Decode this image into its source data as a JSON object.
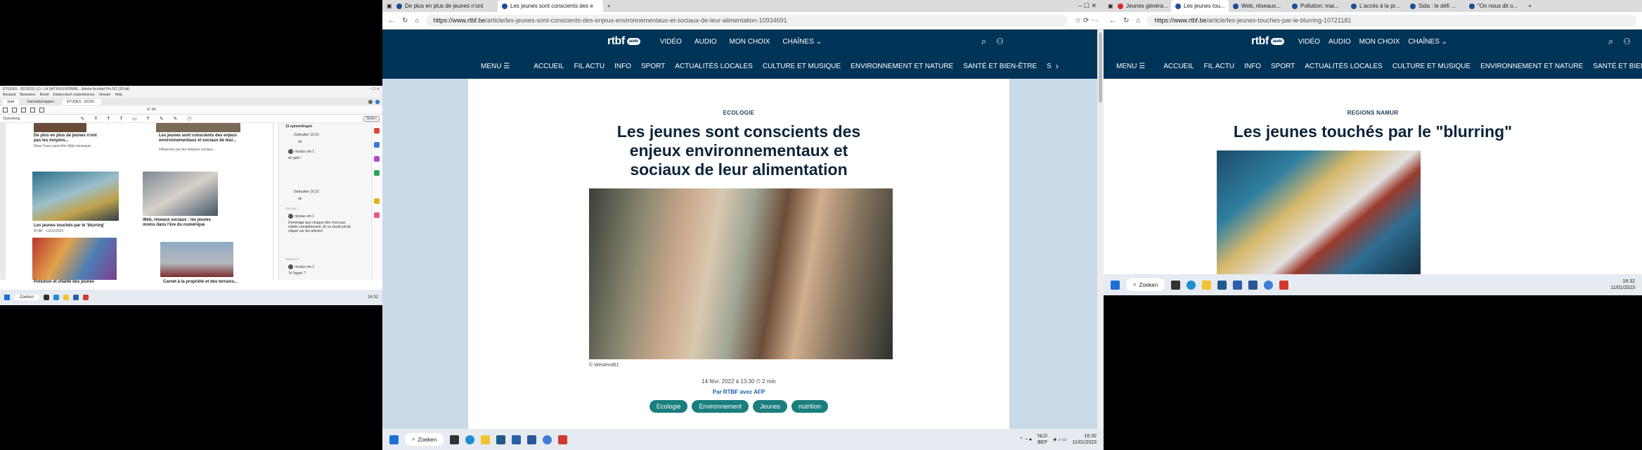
{
  "left_app": {
    "title": "ETUDES - 20230111 (1) - LA SAT EN EXPRIME... Adobe Acrobat Pro DC (32-bit)",
    "menu": [
      "Bestand",
      "Bewerken",
      "Beeld",
      "Elektronisch ondertekenen",
      "Venster",
      "Help"
    ],
    "tabs": [
      "Start",
      "Gereedschappen",
      "ETUDES - 20230..."
    ],
    "page_indicator": "9 / 43",
    "left_label": "Opmerking",
    "share_button": "Sluiten",
    "articles": [
      {
        "title": "De plus en plus de jeunes n'ont pas les moyens...",
        "text": "Nous l'avez peut-être déjà remarqué..."
      },
      {
        "title": "Les jeunes sont conscients des enjeux environnementaux et sociaux de leur...",
        "text": "Influencés par les réseaux sociaux..."
      },
      {
        "title": "Les jeunes touchés par le 'blurring'",
        "text": "RTBF · 11/01/2023"
      },
      {
        "title": "Web, réseaux sociaux : les jeunes moins dans l'ère du numérique",
        "text": ""
      },
      {
        "title": "Pollution et vitalité des jeunes",
        "text": ""
      },
      {
        "title": "Carnet à la propriété et des terrains...",
        "text": ""
      }
    ],
    "comments_header": "15 opmerkingen",
    "comments": [
      {
        "author": "Gebruiker",
        "time": "16:32",
        "text": "ok"
      },
      {
        "author": "nicolas",
        "time": "om 1",
        "text": "en gals !"
      },
      {
        "author": "Gebruiker",
        "time": "16:32",
        "text": "ok"
      },
      {
        "author": "PAGINA 7",
        "time": "",
        "text": ""
      },
      {
        "author": "nicolas",
        "time": "om 1",
        "text": "Dommage que chaque titre n'est pas visible complètement. Et ce serait joli de cliquer sur les articles!"
      },
      {
        "author": "PAGINA 11",
        "time": "",
        "text": ""
      },
      {
        "author": "nicolas",
        "time": "om 1",
        "text": "?o 'legen' ?"
      }
    ],
    "taskbar_search": "Zoeken",
    "clock": "16:32"
  },
  "center_browser": {
    "tabs": [
      {
        "label": "De plus en plus de jeunes n'ont",
        "active": false
      },
      {
        "label": "Les jeunes sont conscients des e",
        "active": true
      }
    ],
    "url_prefix": "https://www.rtbf.be",
    "url_path": "/article/les-jeunes-sont-conscients-des-enjeux-environnementaux-et-sociaux-de-leur-alimentation-10934691",
    "logo": "rtbf",
    "logo_badge": "auvio",
    "top_nav": [
      "VIDÉO",
      "AUDIO",
      "MON CHOIX",
      "CHAÎNES"
    ],
    "menu_label": "MENU",
    "main_nav": [
      "ACCUEIL",
      "FIL ACTU",
      "INFO",
      "SPORT",
      "ACTUALITÉS LOCALES",
      "CULTURE ET MUSIQUE",
      "ENVIRONNEMENT ET NATURE",
      "SANTÉ ET BIEN-ÊTRE",
      "S"
    ],
    "kicker": "ECOLOGIE",
    "headline_lines": [
      "Les jeunes sont conscients des",
      "enjeux environnementaux et",
      "sociaux de leur alimentation"
    ],
    "photo_credit": "© Westend61",
    "date": "14 févr. 2022 à 13:30",
    "read_time": "2 min",
    "byline": "Par RTBF avec AFP",
    "tags": [
      "Ecologie",
      "Environnement",
      "Jeunes",
      "nutrition"
    ],
    "taskbar_search": "Zoeken",
    "tray_lang": "NLD",
    "tray_layout": "BEP",
    "clock_time": "16:32",
    "clock_date": "11/01/2023",
    "colors": {
      "header": "#003358",
      "page_bg": "#c9dbe8",
      "tag": "#1b7e7e"
    }
  },
  "right_browser": {
    "tabs": [
      {
        "label": "Jeunes généra...",
        "active": false
      },
      {
        "label": "Les jeunes tou...",
        "active": true
      },
      {
        "label": "Web, réseaux...",
        "active": false
      },
      {
        "label": "Pollution: mai...",
        "active": false
      },
      {
        "label": "L'accès à la pr...",
        "active": false
      },
      {
        "label": "Sida : le défi ...",
        "active": false
      },
      {
        "label": "\"On nous dit o...",
        "active": false
      }
    ],
    "url_prefix": "https://www.rtbf.be",
    "url_path": "/article/les-jeunes-touches-par-le-blurring-10721181",
    "logo": "rtbf",
    "logo_badge": "auvio",
    "top_nav": [
      "VIDÉO",
      "AUDIO",
      "MON CHOIX",
      "CHAÎNES"
    ],
    "menu_label": "MENU",
    "main_nav": [
      "ACCUEIL",
      "FIL ACTU",
      "INFO",
      "SPORT",
      "ACTUALITÉS LOCALES",
      "CULTURE ET MUSIQUE",
      "ENVIRONNEMENT ET NATURE",
      "SANTÉ ET BIEN-ÊTRE"
    ],
    "kicker": "REGIONS NAMUR",
    "headline": "Les jeunes touchés par le \"blurring\"",
    "taskbar_search": "Zoeken",
    "clock_time": "16:32",
    "clock_date": "11/01/2023"
  }
}
